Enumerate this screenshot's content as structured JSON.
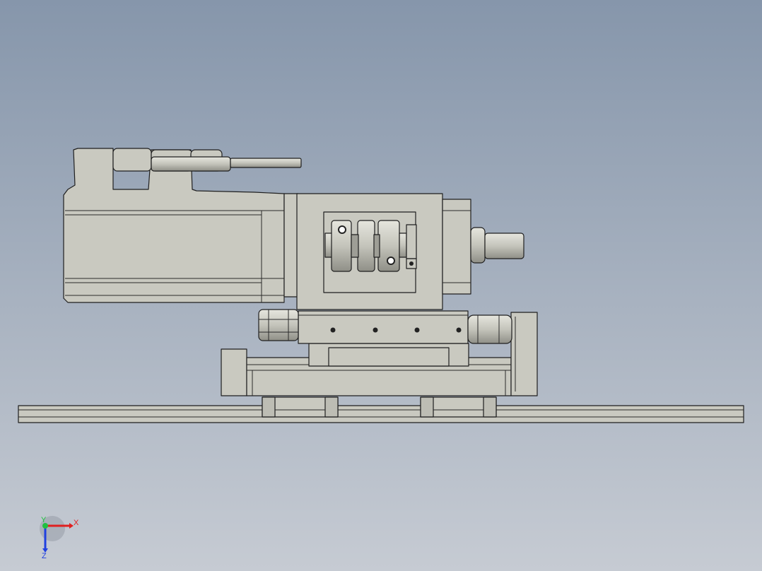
{
  "viewport": {
    "background_top": "#8696ab",
    "background_bottom": "#c6cbd3"
  },
  "model": {
    "part_color": "#c9c9c0",
    "part_shadow": "#a9a9a0",
    "edge_color": "#1f1f1f",
    "hole_color": "#222222"
  },
  "triad": {
    "x_label": "X",
    "y_label": "Y",
    "z_label": "Z",
    "x_color": "#e02020",
    "y_color": "#20c040",
    "z_color": "#2040e0"
  }
}
